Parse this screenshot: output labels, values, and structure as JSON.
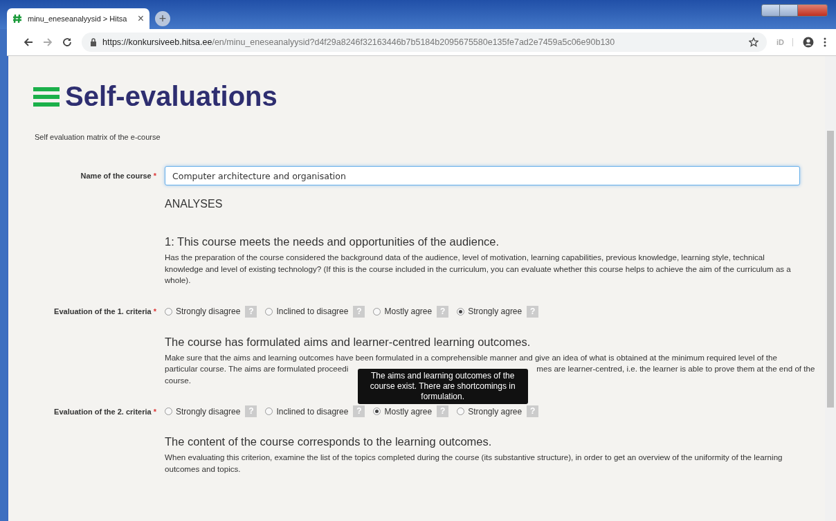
{
  "browser": {
    "tab_title": "minu_eneseanalyysid > Hitsa",
    "tab_close": "×",
    "new_tab": "+",
    "url_host": "https://konkursiveeb.hitsa.ee",
    "url_path": "/en/minu_eneseanalyysid?d4f29a8246f32163446b7b5184b2095675580e135fe7ad2e7459a5c06e90b130",
    "ext_label": "iD"
  },
  "page": {
    "title": "Self-evaluations",
    "subtitle": "Self evaluation matrix of the e-course",
    "course_field": {
      "label": "Name of the course",
      "required": "*",
      "value": "Computer architecture and organisation"
    },
    "section": "ANALYSES",
    "criteria": [
      {
        "title": "1: This course meets the needs and opportunities of the audience.",
        "description_lines": [
          [
            "Has the preparation of the course considered the background data of the audience, level of motivation, learning capabilities, previous knowledge, learning style, technical"
          ],
          [
            "knowledge and level of existing technology? (If this is the course included in the curriculum, you can evaluate whether this course helps to achieve the aim of the curriculum as a"
          ],
          [
            "whole)."
          ]
        ],
        "label": "Evaluation of the 1. criteria",
        "required": "*",
        "options": [
          {
            "label": "Strongly disagree",
            "selected": false,
            "help": "?"
          },
          {
            "label": "Inclined to disagree",
            "selected": false,
            "help": "?"
          },
          {
            "label": "Mostly agree",
            "selected": false,
            "help": "?"
          },
          {
            "label": "Strongly agree",
            "selected": true,
            "help": "?"
          }
        ]
      },
      {
        "title": "The course has formulated aims and learner-centred learning outcomes.",
        "description_lines": [
          [
            "Make sure that the aims and learning outcomes have been formulated in a comprehensible manner and give an idea of what is obtained at the minimum required level of the"
          ],
          [
            "particular course. The aims are formulated proceedi",
            "mes are learner-centred, i.e. the learner is able to prove them at the end of the"
          ],
          [
            "course."
          ]
        ],
        "label": "Evaluation of the 2. criteria",
        "required": "*",
        "options": [
          {
            "label": "Strongly disagree",
            "selected": false,
            "help": "?"
          },
          {
            "label": "Inclined to disagree",
            "selected": false,
            "help": "?"
          },
          {
            "label": "Mostly agree",
            "selected": true,
            "help": "?",
            "tooltip": "The aims and learning outcomes of the course exist. There are shortcomings in formulation."
          },
          {
            "label": "Strongly agree",
            "selected": false,
            "help": "?"
          }
        ]
      },
      {
        "title": "The content of the course corresponds to the learning outcomes.",
        "description_lines": [
          [
            "When evaluating this criterion, examine the list of the topics completed during the course (its substantive structure), in order to get an overview of the uniformity of the learning"
          ],
          [
            "outcomes and topics."
          ]
        ]
      }
    ]
  }
}
